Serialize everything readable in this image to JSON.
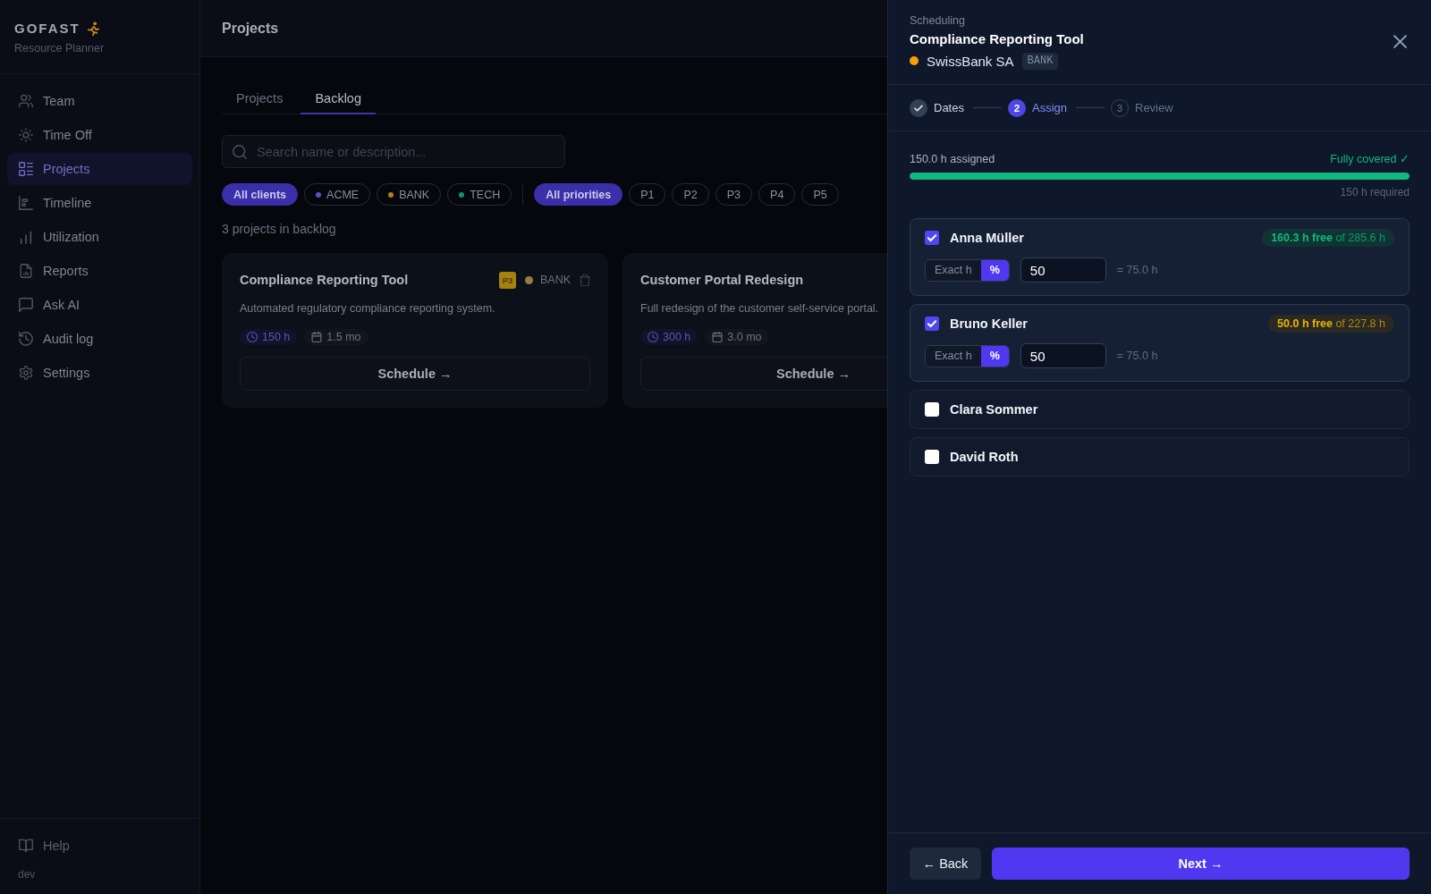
{
  "sidebar": {
    "logo": "GOFAST",
    "subtitle": "Resource Planner",
    "items": [
      {
        "label": "Team",
        "selected": false
      },
      {
        "label": "Time Off",
        "selected": false
      },
      {
        "label": "Projects",
        "selected": true
      },
      {
        "label": "Timeline",
        "selected": false
      },
      {
        "label": "Utilization",
        "selected": false
      },
      {
        "label": "Reports",
        "selected": false
      },
      {
        "label": "Ask AI",
        "selected": false
      },
      {
        "label": "Audit log",
        "selected": false
      },
      {
        "label": "Settings",
        "selected": false
      }
    ],
    "help": "Help",
    "version": "dev"
  },
  "main": {
    "title": "Projects",
    "tabs": [
      {
        "label": "Projects",
        "selected": false
      },
      {
        "label": "Backlog",
        "selected": true
      }
    ],
    "search": {
      "placeholder": "Search name or description..."
    },
    "client_filters": [
      {
        "label": "All clients",
        "selected": true
      },
      {
        "label": "ACME",
        "selected": false,
        "color": "#5a52c8"
      },
      {
        "label": "BANK",
        "selected": false,
        "color": "#b97a1c"
      },
      {
        "label": "TECH",
        "selected": false,
        "color": "#12946a"
      }
    ],
    "priority_filters": [
      {
        "label": "All priorities",
        "selected": true
      },
      {
        "label": "P1",
        "selected": false
      },
      {
        "label": "P2",
        "selected": false
      },
      {
        "label": "P3",
        "selected": false
      },
      {
        "label": "P4",
        "selected": false
      },
      {
        "label": "P5",
        "selected": false
      }
    ],
    "count": "3 projects in backlog",
    "cards": [
      {
        "title": "Compliance Reporting Tool",
        "priority": {
          "label": "P3",
          "color": "#a5820f"
        },
        "client": {
          "label": "BANK",
          "color": "#9d7a44"
        },
        "deletable": true,
        "description": "Automated regulatory compliance reporting system.",
        "hours": "150 h",
        "duration": "1.5 mo",
        "action": "Schedule →"
      },
      {
        "title": "Customer Portal Redesign",
        "deletable": false,
        "description": "Full redesign of the customer self-service portal.",
        "hours": "300 h",
        "duration": "3.0 mo",
        "action": "Schedule →"
      }
    ]
  },
  "panel": {
    "eyebrow": "Scheduling",
    "title": "Compliance Reporting Tool",
    "client": {
      "name": "SwissBank SA",
      "code": "BANK",
      "color": "#f59e0b"
    },
    "steps": [
      {
        "label": "Dates",
        "completed": true,
        "selected": false
      },
      {
        "number": "2",
        "label": "Assign",
        "completed": false,
        "selected": true
      },
      {
        "number": "3",
        "label": "Review",
        "completed": false,
        "selected": false
      }
    ],
    "summary": {
      "assigned": "150.0 h assigned",
      "status": "Fully covered ✓",
      "level": 1,
      "required": "150 h required"
    },
    "people": [
      {
        "name": "Anna Müller",
        "checked": true,
        "availability": "**160.3 h free** of 285.6 h",
        "low_availability": false,
        "modes": [
          {
            "label": "Exact h",
            "selected": false
          },
          {
            "label": "%",
            "selected": true
          }
        ],
        "value": "50",
        "result": "= 75.0 h"
      },
      {
        "name": "Bruno Keller",
        "checked": true,
        "availability": "**50.0 h free** of 227.8 h",
        "low_availability": true,
        "modes": [
          {
            "label": "Exact h",
            "selected": false
          },
          {
            "label": "%",
            "selected": true
          }
        ],
        "value": "50",
        "result": "= 75.0 h"
      },
      {
        "name": "Clara Sommer",
        "checked": false
      },
      {
        "name": "David Roth",
        "checked": false
      }
    ],
    "back": "← Back",
    "next": "Next →"
  }
}
